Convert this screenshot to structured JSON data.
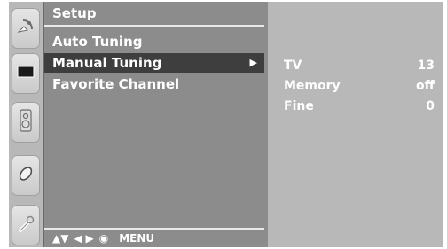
{
  "sidebar": {
    "icons": [
      "satellite-dish-icon",
      "tv-screen-icon",
      "speaker-icon",
      "disc-icon",
      "wrench-icon"
    ]
  },
  "menu": {
    "title": "Setup",
    "items": [
      {
        "label": "Auto Tuning"
      },
      {
        "label": "Manual Tuning",
        "arrow": "▶"
      },
      {
        "label": "Favorite Channel"
      }
    ],
    "selected_index": 1
  },
  "footer": {
    "up_down": "▲▼",
    "left_right": "◀ ▶",
    "ok_symbol": "◉",
    "menu_label": "MENU"
  },
  "detail": {
    "rows": [
      {
        "label": "TV",
        "value": "13"
      },
      {
        "label": "Memory",
        "value": "off"
      },
      {
        "label": "Fine",
        "value": "0"
      }
    ]
  }
}
